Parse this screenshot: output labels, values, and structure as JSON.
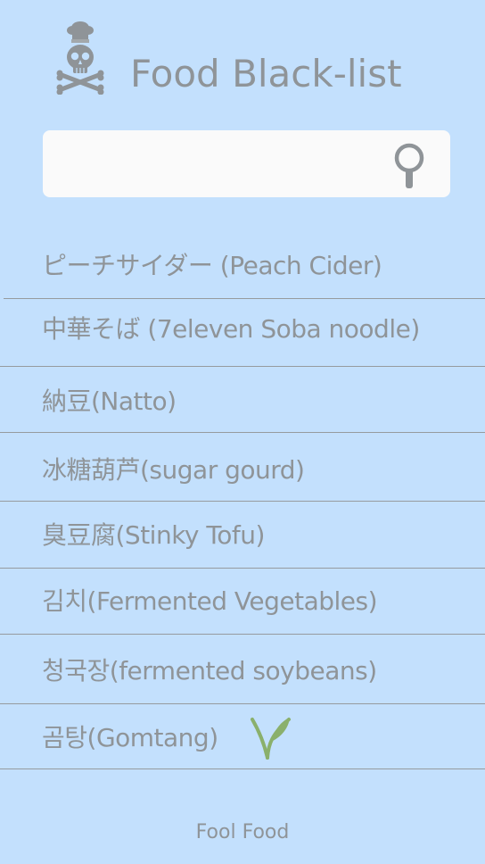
{
  "header": {
    "title": "Food Black-list",
    "logo_icon": "skull-chef-icon"
  },
  "search": {
    "value": "",
    "placeholder": "",
    "icon": "magnifier-icon"
  },
  "list": {
    "items": [
      {
        "label": "ピーチサイダー (Peach Cider)"
      },
      {
        "label": "中華そば (7eleven Soba noodle)"
      },
      {
        "label": "納豆(Natto)"
      },
      {
        "label": "冰糖葫芦(sugar gourd)"
      },
      {
        "label": "臭豆腐(Stinky Tofu)"
      },
      {
        "label": "김치(Fermented Vegetables)"
      },
      {
        "label": "청국장(fermented soybeans)"
      },
      {
        "label": "곰탕(Gomtang)",
        "icon": "leaf-sprout-icon"
      }
    ]
  },
  "footer": {
    "text": "Fool Food"
  },
  "colors": {
    "background": "#c3e0fd",
    "text": "#8f9498",
    "search_bg": "#fafafa",
    "divider": "#969b9f",
    "leaf": "#8ab06c"
  }
}
